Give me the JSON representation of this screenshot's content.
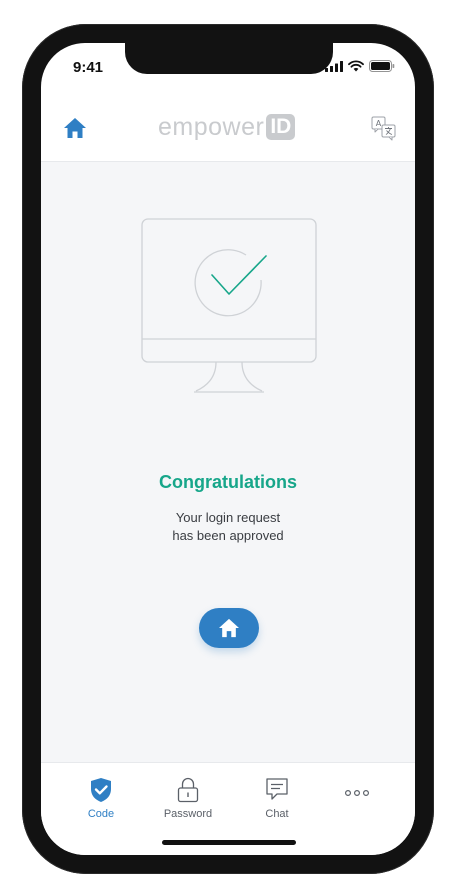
{
  "status_bar": {
    "time": "9:41"
  },
  "header": {
    "logo_word": "empower",
    "logo_badge": "ID",
    "home_icon": "home-icon",
    "language_icon": "translate-icon"
  },
  "main": {
    "title": "Congratulations",
    "subtitle_line1": "Your login request",
    "subtitle_line2": "has been approved",
    "illustration_icon": "monitor-check-icon",
    "home_button_icon": "home-icon"
  },
  "tabs": [
    {
      "label": "Code",
      "icon": "shield-check-icon",
      "active": true
    },
    {
      "label": "Password",
      "icon": "lock-icon",
      "active": false
    },
    {
      "label": "Chat",
      "icon": "chat-icon",
      "active": false
    },
    {
      "label": "",
      "icon": "more-icon",
      "active": false
    }
  ],
  "colors": {
    "accent": "#2f7fc4",
    "success": "#17a68a",
    "background": "#f5f6f8"
  }
}
